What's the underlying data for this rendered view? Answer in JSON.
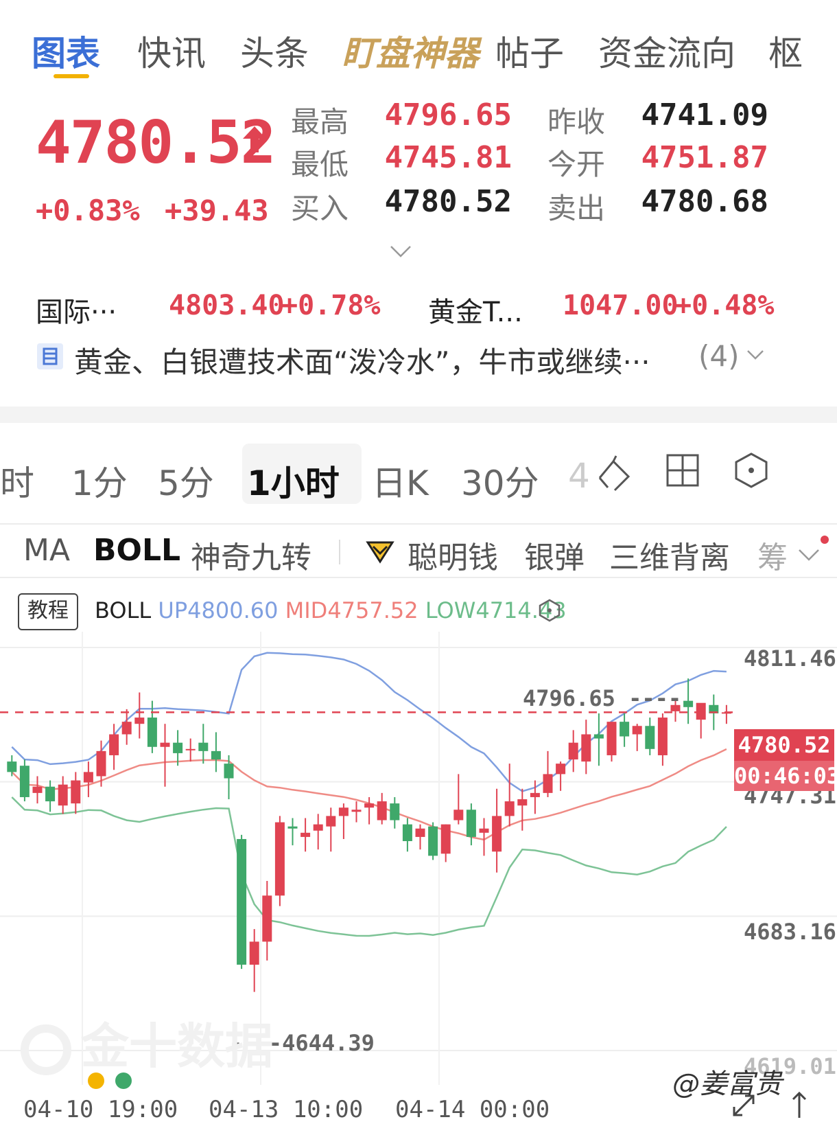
{
  "nav": {
    "tabs": [
      "图表",
      "快讯",
      "头条",
      "盯盘神器",
      "帖子",
      "资金流向",
      "枢"
    ]
  },
  "quote": {
    "price": "4780.52",
    "change_pct": "+0.83%",
    "change": "+39.43",
    "high_label": "最高",
    "high": "4796.65",
    "low_label": "最低",
    "low": "4745.81",
    "bid_label": "买入",
    "bid": "4780.52",
    "prev_close_label": "昨收",
    "prev_close": "4741.09",
    "open_label": "今开",
    "open": "4751.87",
    "ask_label": "卖出",
    "ask": "4780.68"
  },
  "related": [
    {
      "name": "国际···",
      "price": "4803.40",
      "pct": "+0.78%"
    },
    {
      "name": "黄金T...",
      "price": "1047.00",
      "pct": "+0.48%"
    }
  ],
  "news": {
    "headline": "黄金、白银遭技术面“泼冷水”，牛市或继续···",
    "count": "(4)"
  },
  "periods": [
    "时",
    "1分",
    "5分",
    "1小时",
    "日K",
    "30分",
    "4"
  ],
  "indicators": [
    "MA",
    "BOLL",
    "神奇九转",
    "聪明钱",
    "银弹",
    "三维背离",
    "筹"
  ],
  "colors": {
    "up": "#e04352",
    "down": "#3fa86a",
    "upper": "#7f9fe0",
    "mid": "#ef8b85",
    "lower": "#7dc396"
  },
  "chart_data": {
    "type": "candlestick",
    "tutorial_label": "教程",
    "legend": {
      "name": "BOLL",
      "up": "UP4800.60",
      "mid": "MID4757.52",
      "low": "LOW4714.43"
    },
    "y_ticks": [
      "4811.46",
      "4747.31",
      "4683.16",
      "4619.01"
    ],
    "ylim": [
      4619.01,
      4811.46
    ],
    "x_ticks": [
      "04-10 19:00",
      "04-13 10:00",
      "04-14 00:00"
    ],
    "last_price_tag": "4780.52",
    "countdown_tag": "00:46:03",
    "high_annotation": "4796.65",
    "low_annotation": "4644.39",
    "watermark": "金十数据",
    "credit": "@姜富贵",
    "candles": [
      [
        4757,
        4760,
        4750,
        4752
      ],
      [
        4755,
        4758,
        4738,
        4740
      ],
      [
        4742,
        4750,
        4737,
        4745
      ],
      [
        4745,
        4748,
        4733,
        4738
      ],
      [
        4736,
        4750,
        4732,
        4746
      ],
      [
        4737,
        4752,
        4732,
        4748
      ],
      [
        4747,
        4757,
        4740,
        4752
      ],
      [
        4750,
        4767,
        4745,
        4762
      ],
      [
        4760,
        4775,
        4753,
        4770
      ],
      [
        4770,
        4782,
        4765,
        4776
      ],
      [
        4775,
        4790,
        4768,
        4778
      ],
      [
        4778,
        4786,
        4761,
        4764
      ],
      [
        4764,
        4775,
        4745,
        4766
      ],
      [
        4766,
        4772,
        4755,
        4761
      ],
      [
        4763,
        4768,
        4757,
        4763
      ],
      [
        4766,
        4775,
        4756,
        4762
      ],
      [
        4762,
        4771,
        4752,
        4758
      ],
      [
        4756,
        4760,
        4739,
        4749
      ],
      [
        4720,
        4722,
        4658,
        4660
      ],
      [
        4660,
        4677,
        4647,
        4671
      ],
      [
        4671,
        4700,
        4662,
        4693
      ],
      [
        4693,
        4731,
        4688,
        4728
      ],
      [
        4726,
        4730,
        4717,
        4725
      ],
      [
        4721,
        4730,
        4714,
        4723
      ],
      [
        4724,
        4732,
        4715,
        4727
      ],
      [
        4726,
        4735,
        4714,
        4731
      ],
      [
        4731,
        4737,
        4720,
        4735
      ],
      [
        4733,
        4738,
        4728,
        4734
      ],
      [
        4735,
        4740,
        4727,
        4737
      ],
      [
        4729,
        4742,
        4727,
        4738
      ],
      [
        4737,
        4740,
        4725,
        4729
      ],
      [
        4727,
        4730,
        4714,
        4719
      ],
      [
        4721,
        4727,
        4715,
        4725
      ],
      [
        4726,
        4728,
        4710,
        4712
      ],
      [
        4713,
        4727,
        4709,
        4727
      ],
      [
        4729,
        4751,
        4727,
        4734
      ],
      [
        4734,
        4737,
        4717,
        4721
      ],
      [
        4723,
        4730,
        4712,
        4725
      ],
      [
        4714,
        4744,
        4704,
        4731
      ],
      [
        4731,
        4756,
        4726,
        4738
      ],
      [
        4736,
        4744,
        4724,
        4739
      ],
      [
        4740,
        4748,
        4732,
        4742
      ],
      [
        4742,
        4762,
        4740,
        4751
      ],
      [
        4751,
        4757,
        4743,
        4756
      ],
      [
        4758,
        4772,
        4752,
        4766
      ],
      [
        4757,
        4777,
        4751,
        4770
      ],
      [
        4770,
        4780,
        4755,
        4768
      ],
      [
        4760,
        4774,
        4757,
        4776
      ],
      [
        4776,
        4780,
        4764,
        4769
      ],
      [
        4770,
        4775,
        4762,
        4774
      ],
      [
        4774,
        4778,
        4760,
        4763
      ],
      [
        4760,
        4780,
        4755,
        4778
      ],
      [
        4781,
        4786,
        4776,
        4784
      ],
      [
        4786,
        4796.65,
        4775,
        4783
      ],
      [
        4777,
        4784,
        4768,
        4785
      ],
      [
        4784,
        4789,
        4772,
        4780
      ],
      [
        4780,
        4784,
        4775,
        4780.52
      ]
    ]
  }
}
